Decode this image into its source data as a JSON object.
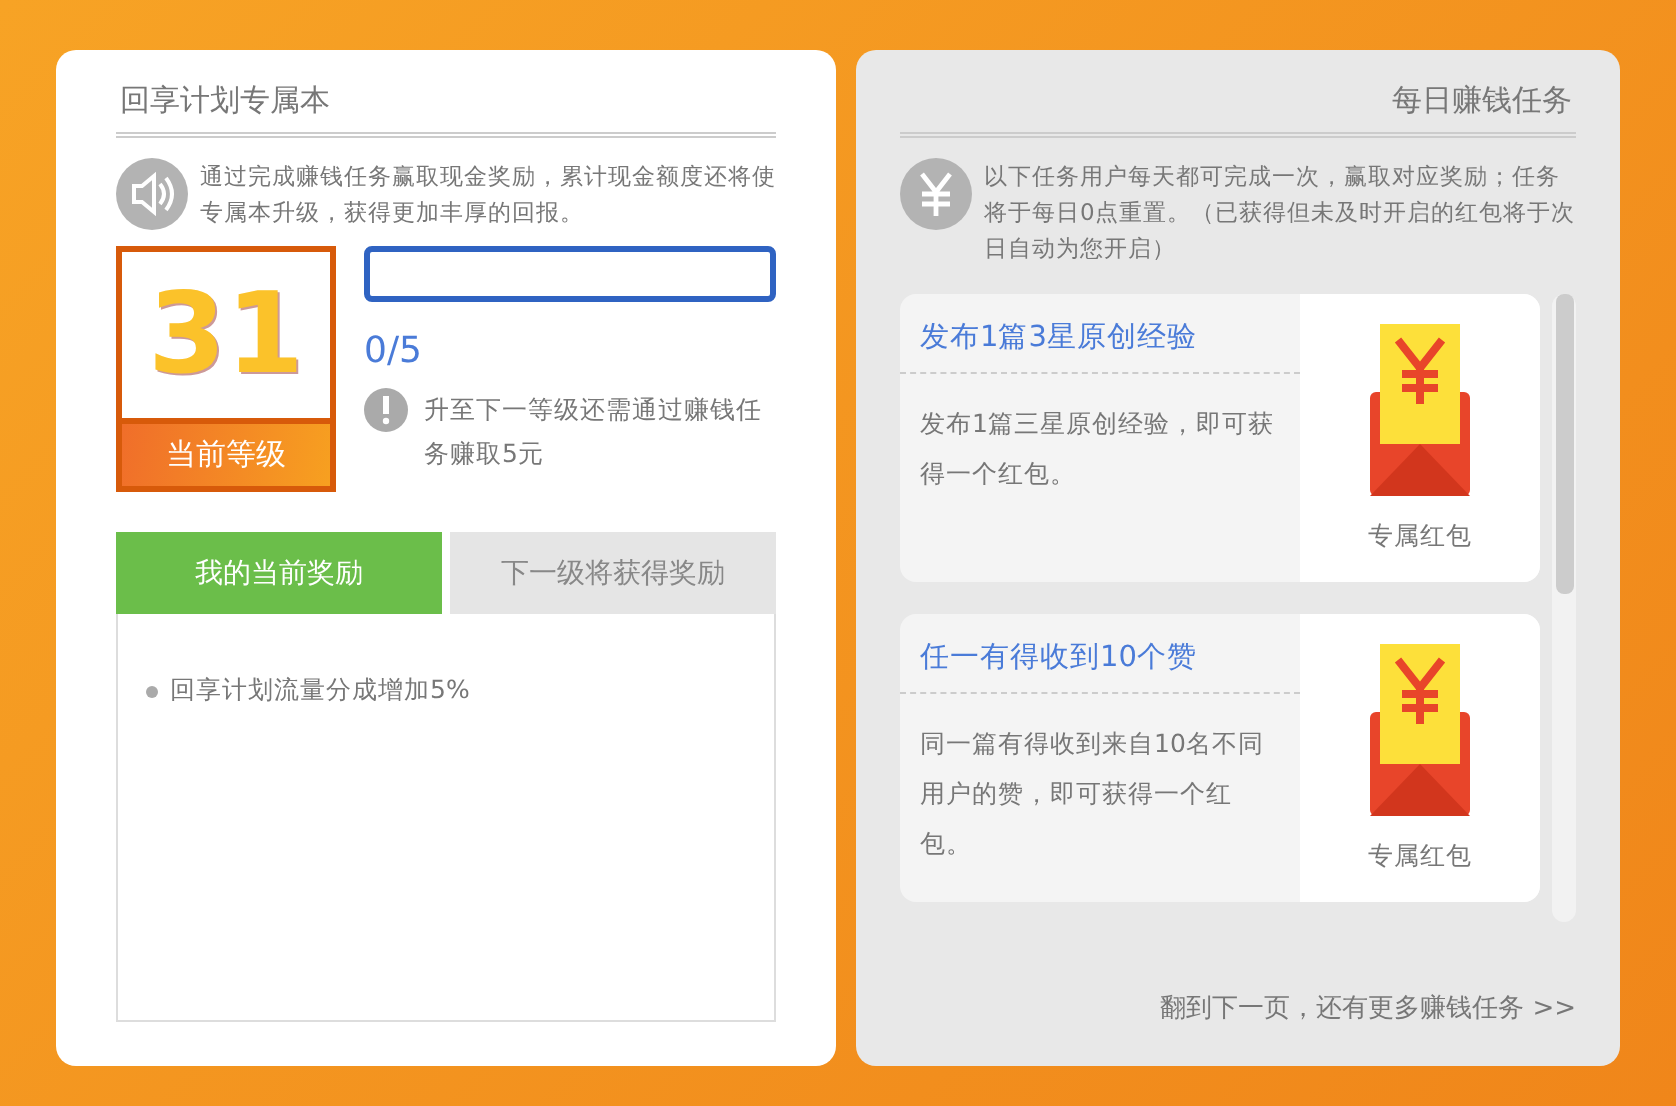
{
  "left_page": {
    "title": "回享计划专属本",
    "notice": "通过完成赚钱任务赢取现金奖励，累计现金额度还将使专属本升级，获得更加丰厚的回报。",
    "level_badge": {
      "number": "31",
      "label": "当前等级"
    },
    "progress": {
      "level": 0,
      "reading": "0/5"
    },
    "hint": "升至下一等级还需通过赚钱任务赚取5元",
    "tabs": [
      {
        "label": "我的当前奖励",
        "selected": true
      },
      {
        "label": "下一级将获得奖励",
        "selected": false
      }
    ],
    "rewards": [
      "回享计划流量分成增加5%"
    ]
  },
  "right_page": {
    "title": "每日赚钱任务",
    "notice": "以下任务用户每天都可完成一次，赢取对应奖励；任务将于每日0点重置。（已获得但未及时开启的红包将于次日自动为您开启）",
    "tasks": [
      {
        "title": "发布1篇3星原创经验",
        "description": "发布1篇三星原创经验，即可获得一个红包。",
        "reward": "专属红包"
      },
      {
        "title": "任一有得收到10个赞",
        "description": "同一篇有得收到来自10名不同用户的赞，即可获得一个红包。",
        "reward": "专属红包"
      }
    ],
    "footer": "翻到下一页，还有更多赚钱任务 >>"
  }
}
